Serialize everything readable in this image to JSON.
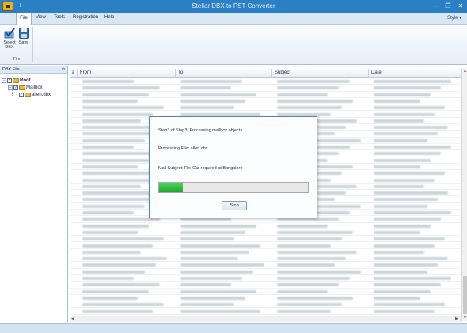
{
  "window": {
    "title": "Stellar DBX to PST Converter",
    "controls": [
      "–",
      "❐",
      "✕"
    ]
  },
  "menu": {
    "items": [
      "File",
      "View",
      "Tools",
      "Registration",
      "Help"
    ],
    "style_label": "Style",
    "style_arrow": "▾"
  },
  "ribbon": {
    "select_label_1": "Select",
    "select_label_2": "DBX",
    "save_label": "Save",
    "group_label": "File"
  },
  "left_panel": {
    "header": "DBX File",
    "pin": "ф",
    "tree": {
      "root": "Root",
      "mailbox": "Mailbox",
      "file": "allen.dbx"
    }
  },
  "grid": {
    "attach_header": "ⅱ",
    "columns": [
      "From",
      "To",
      "Subject",
      "Date"
    ]
  },
  "scroll": {
    "up": "▲",
    "down": "▼",
    "left": "◀",
    "right": "▶"
  },
  "dialog": {
    "step_text": "Step3 of Step3: Processing mailbox objects...",
    "processing_file": "Processing File:  allen.dbx",
    "mail_subject": "Mail Subject:  Re: Car required at Bangalore",
    "progress_fraction": 0.16,
    "stop_label": "Stop"
  },
  "colors": {
    "titlebar": "#2b7fc4",
    "progress": "#22a832"
  }
}
